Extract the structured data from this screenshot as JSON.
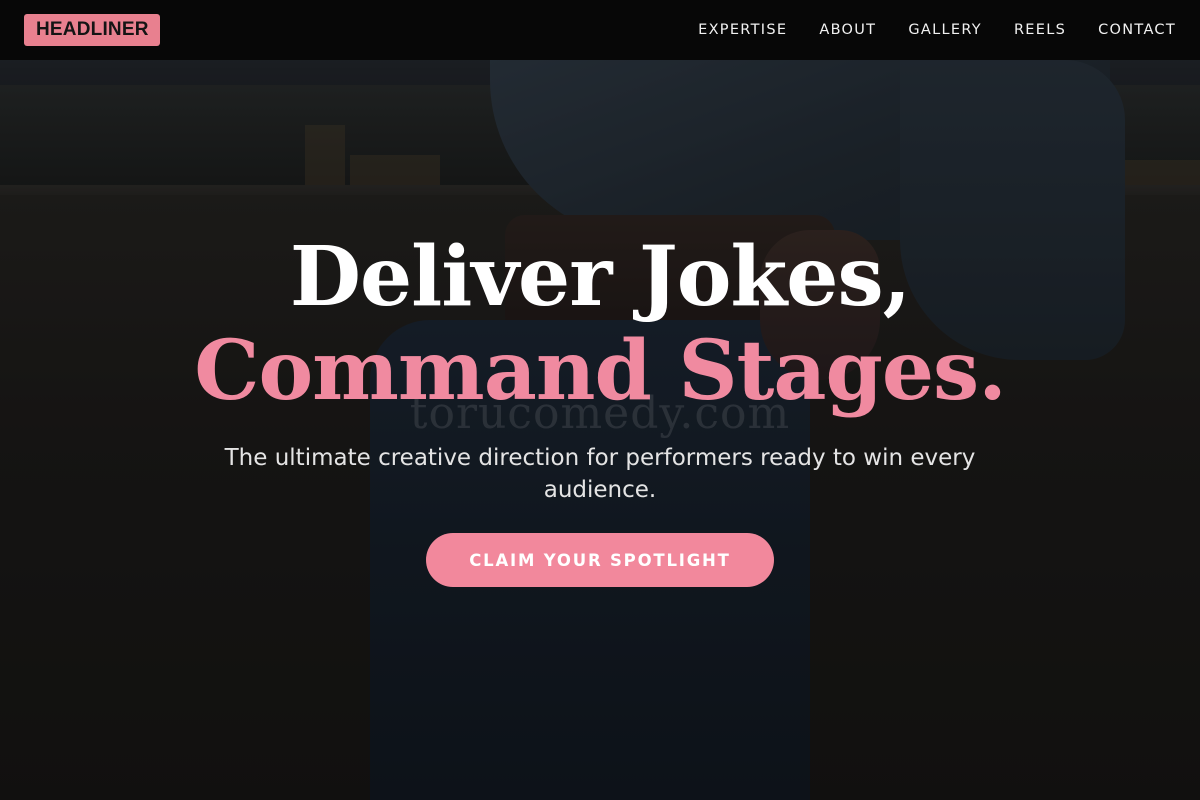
{
  "brand": {
    "logo_text": "HEADLINER"
  },
  "nav": {
    "items": [
      {
        "label": "EXPERTISE"
      },
      {
        "label": "ABOUT"
      },
      {
        "label": "GALLERY"
      },
      {
        "label": "REELS"
      },
      {
        "label": "CONTACT"
      }
    ]
  },
  "hero": {
    "headline_line1": "Deliver Jokes,",
    "headline_line2": "Command Stages.",
    "subtitle": "The ultimate creative direction for performers ready to win every audience.",
    "cta_label": "CLAIM YOUR SPOTLIGHT",
    "watermark": "torucomedy.com"
  },
  "colors": {
    "accent": "#f08aa0",
    "navbar_bg": "#070707",
    "logo_bg": "#e8808f"
  }
}
